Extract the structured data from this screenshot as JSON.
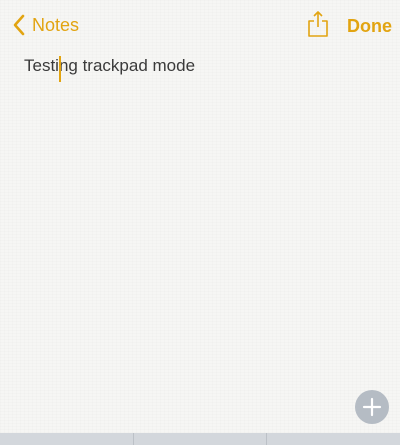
{
  "nav": {
    "back_label": "Notes",
    "done_label": "Done"
  },
  "note": {
    "text": "Testing trackpad mode"
  },
  "colors": {
    "accent": "#e2a411",
    "paper": "#f6f6f4",
    "text": "#3a3a3a",
    "add_button": "#b5bcc4",
    "keyboard": "#cfd3d9"
  },
  "icons": {
    "back": "chevron-left-icon",
    "share": "share-icon",
    "add": "plus-icon"
  },
  "keyboard": {
    "keys": [
      "",
      "",
      ""
    ]
  }
}
